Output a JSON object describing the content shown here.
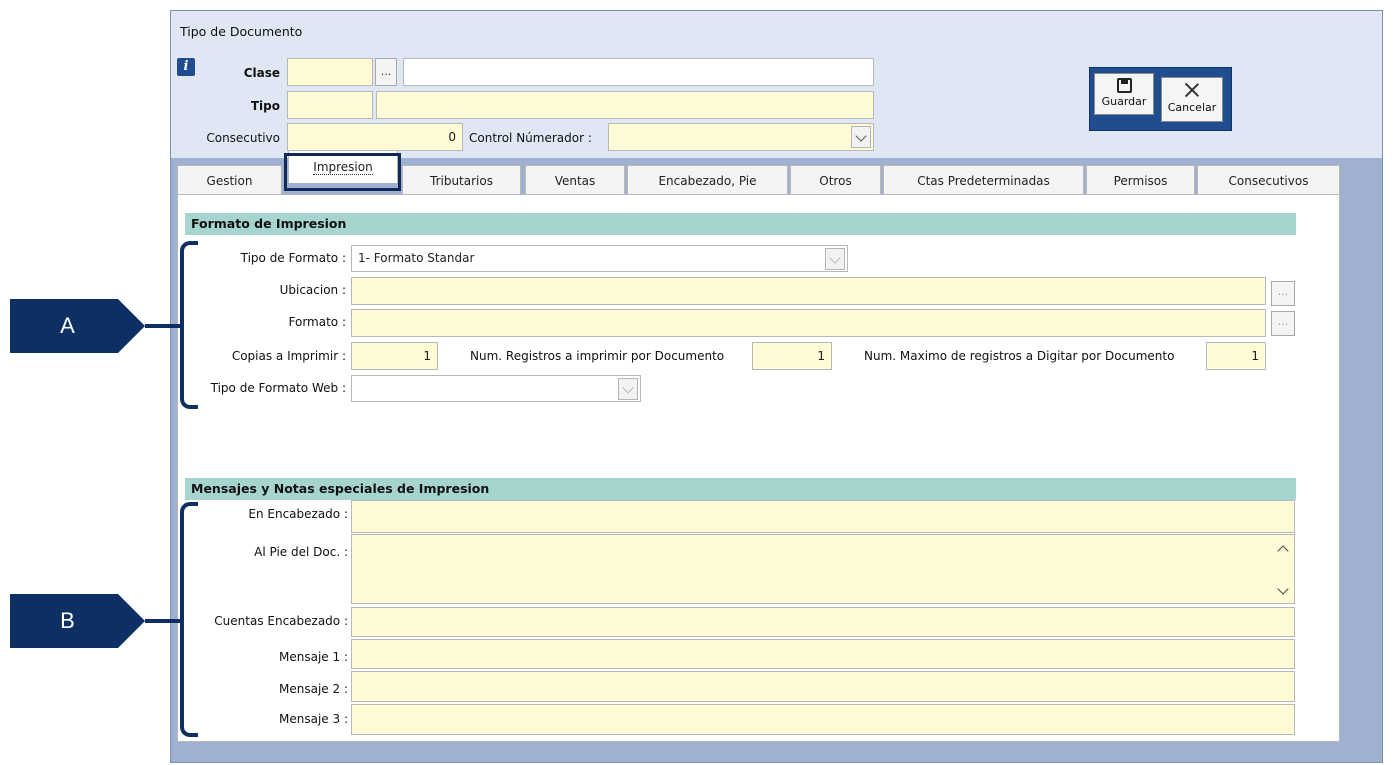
{
  "window": {
    "title": "Tipo de Documento"
  },
  "header": {
    "clase_label": "Clase",
    "clase_button": "...",
    "tipo_label": "Tipo",
    "consecutivo_label": "Consecutivo",
    "consecutivo_value": "0",
    "control_label": "Control Númerador :"
  },
  "toolbar": {
    "save_label": "Guardar",
    "cancel_label": "Cancelar"
  },
  "tabs": [
    {
      "label": "Gestion"
    },
    {
      "label": "Impresion"
    },
    {
      "label": "Tributarios"
    },
    {
      "label": "Ventas"
    },
    {
      "label": "Encabezado, Pie"
    },
    {
      "label": "Otros"
    },
    {
      "label": "Ctas Predeterminadas"
    },
    {
      "label": "Permisos"
    },
    {
      "label": "Consecutivos"
    }
  ],
  "active_tab": "Impresion",
  "formato": {
    "section_title": "Formato de Impresion",
    "tipo_formato_label": "Tipo de Formato :",
    "tipo_formato_value": "1- Formato Standar",
    "ubicacion_label": "Ubicacion :",
    "formato_label": "Formato :",
    "browse_button": "...",
    "copias_label": "Copias a Imprimir :",
    "copias_value": "1",
    "num_registros_label": "Num. Registros a imprimir  por Documento",
    "num_registros_value": "1",
    "num_maximo_label": "Num. Maximo de registros a Digitar por Documento",
    "num_maximo_value": "1",
    "tipo_web_label": "Tipo de Formato Web :"
  },
  "mensajes": {
    "section_title": "Mensajes  y  Notas especiales de Impresion",
    "encabezado_label": "En Encabezado :",
    "pie_label": "Al Pie del Doc. :",
    "cuentas_label": "Cuentas Encabezado :",
    "mensaje1_label": "Mensaje 1 :",
    "mensaje2_label": "Mensaje 2 :",
    "mensaje3_label": "Mensaje 3 :"
  },
  "callouts": {
    "a": "A",
    "b": "B"
  },
  "colors": {
    "accent": "#0e2f63",
    "field_bg": "#fffbd6",
    "section_bg": "#a6d5d0",
    "window_bg": "#9fb0d0"
  }
}
